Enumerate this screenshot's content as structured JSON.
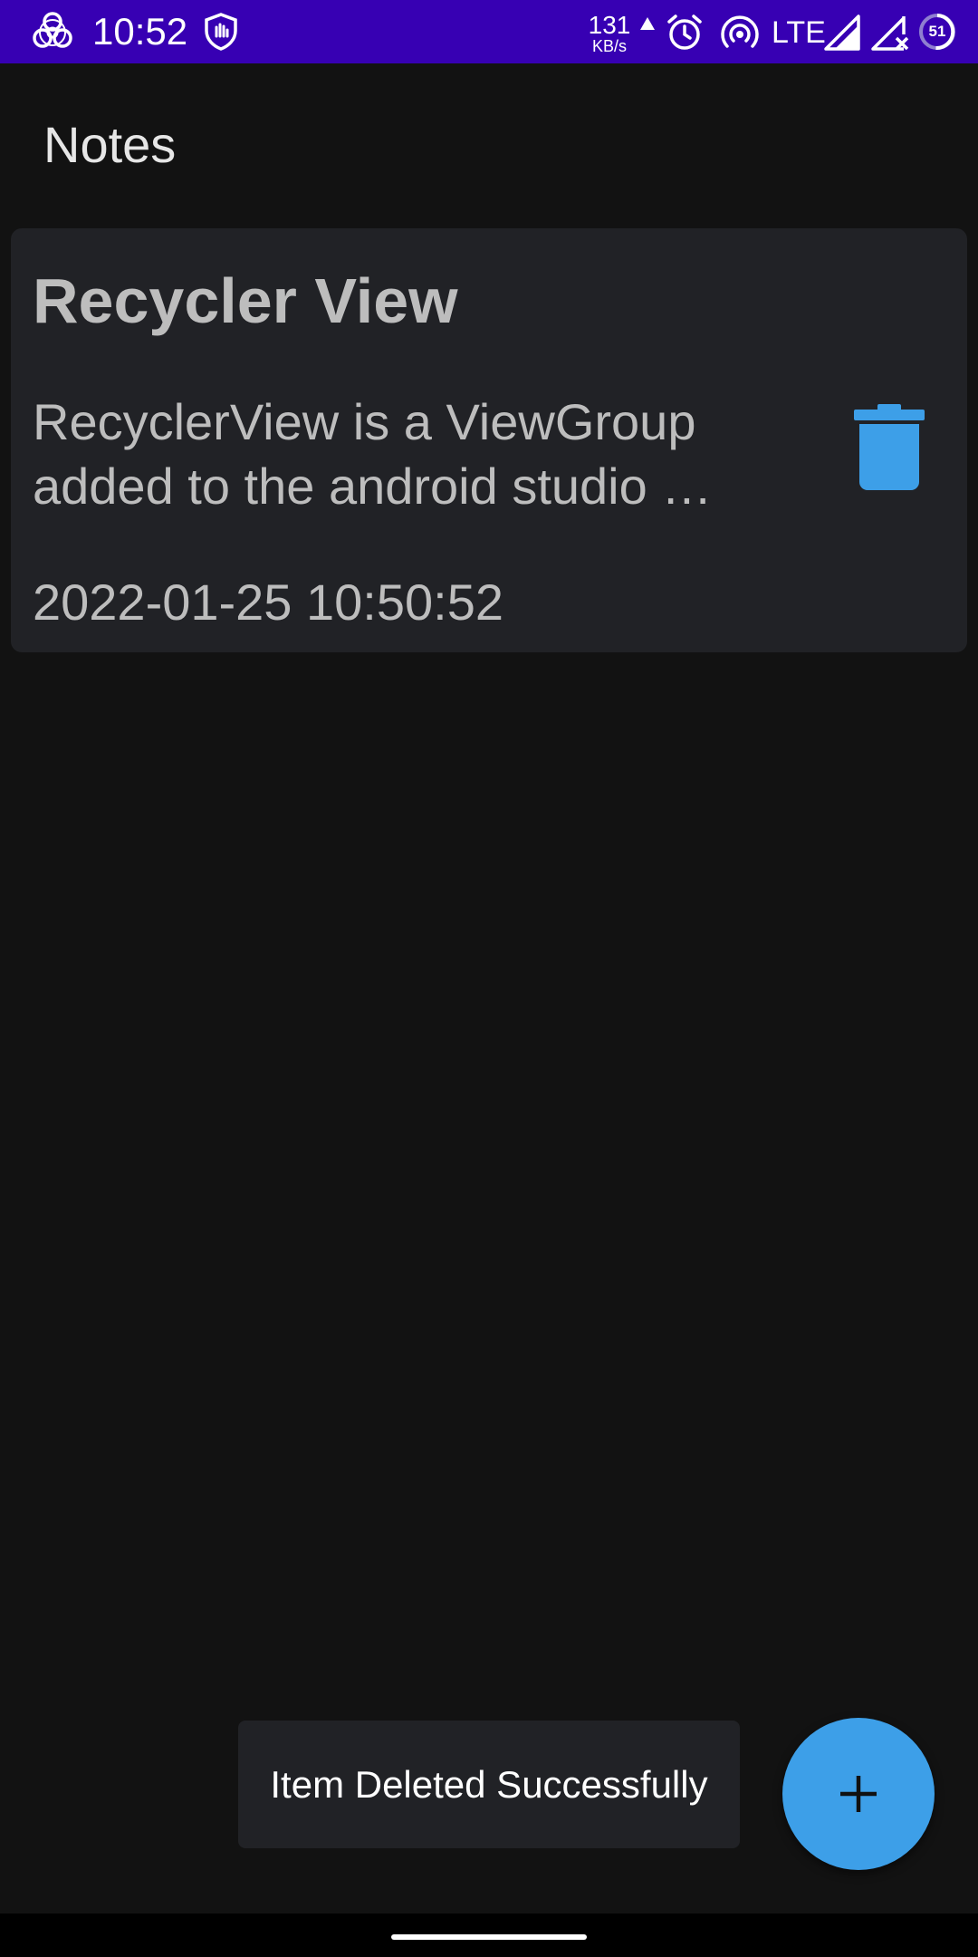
{
  "status_bar": {
    "time": "10:52",
    "net_speed": "131",
    "net_unit": "KB/s",
    "network_type": "LTE",
    "battery": "51",
    "icons": [
      "biohazard-icon",
      "shield-hand-icon",
      "upload-arrow-icon",
      "alarm-icon",
      "hotspot-icon",
      "signal-icon",
      "signal-no-data-icon",
      "battery-icon"
    ],
    "background_color": "#3700B3"
  },
  "app_bar": {
    "title": "Notes"
  },
  "notes": [
    {
      "title": "Recycler View",
      "body": "RecyclerView is a ViewGroup\nadded to the android studio …",
      "date": "2022-01-25 10:50:52",
      "delete_icon": "trash-icon"
    }
  ],
  "snackbar": {
    "message": "Item Deleted Successfully"
  },
  "fab": {
    "icon": "plus-icon"
  },
  "colors": {
    "background": "#121212",
    "card": "#212226",
    "accent": "#3D9FE8",
    "text_secondary": "#BDBDBD"
  }
}
